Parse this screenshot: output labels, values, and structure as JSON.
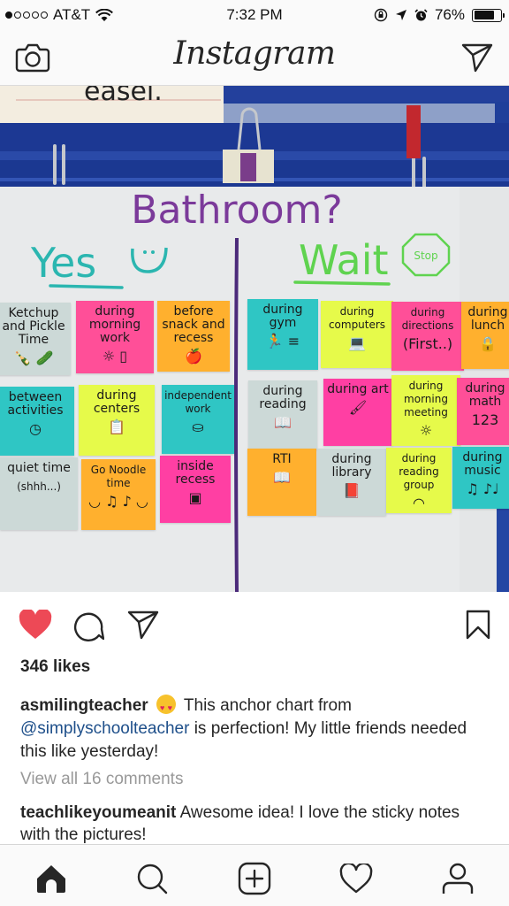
{
  "status_bar": {
    "signal_bars_filled": 1,
    "signal_bars_total": 5,
    "carrier": "AT&T",
    "time": "7:32 PM",
    "battery_percent_label": "76%",
    "battery_level": 0.76
  },
  "header": {
    "logo": "Instagram",
    "icons": [
      "camera-icon",
      "direct-message-icon"
    ]
  },
  "photo": {
    "easel_label": "easel.",
    "chart_title": "Bathroom?",
    "yes_heading": "Yes",
    "wait_heading": "Wait",
    "stop_sign": "stop",
    "yes_notes": [
      {
        "text": "Ketchup and Pickle Time",
        "icon": "🍾 🥒"
      },
      {
        "text": "during morning work",
        "icon": "☼ ▯"
      },
      {
        "text": "before snack and recess",
        "icon": "🍎"
      },
      {
        "text": "between activities",
        "icon": "◷"
      },
      {
        "text": "during centers",
        "icon": "📋"
      },
      {
        "text": "independent work",
        "icon": "⛀"
      },
      {
        "text": "quiet time",
        "icon": "(shhh...)"
      },
      {
        "text": "Go Noodle time",
        "icon": "◡ ♫ ♪ ◡"
      },
      {
        "text": "inside recess",
        "icon": "▣"
      }
    ],
    "wait_notes": [
      {
        "text": "during gym",
        "icon": "🏃 ≡"
      },
      {
        "text": "during computers",
        "icon": "💻"
      },
      {
        "text": "during directions",
        "icon": "(First..)"
      },
      {
        "text": "during lunch",
        "icon": "🔒"
      },
      {
        "text": "during reading",
        "icon": "📖"
      },
      {
        "text": "during art",
        "icon": "🖌"
      },
      {
        "text": "during morning meeting",
        "icon": "☼"
      },
      {
        "text": "during math",
        "icon": "123"
      },
      {
        "text": "RTI",
        "icon": "📖"
      },
      {
        "text": "during library",
        "icon": "📕"
      },
      {
        "text": "during reading group",
        "icon": "◠"
      },
      {
        "text": "during music",
        "icon": "♫ ♪♩"
      }
    ]
  },
  "actions": {
    "liked": true,
    "like_color": "#ed4956",
    "icons": [
      "heart-icon",
      "comment-icon",
      "share-icon",
      "bookmark-icon"
    ]
  },
  "likes_label": "346 likes",
  "caption": {
    "username": "asmilingteacher",
    "emoji": "heart-eyes",
    "text_before_mention": "This anchor chart from",
    "mention": "@simplyschoolteacher",
    "text_after_mention": " is perfection! My little friends needed this like yesterday!"
  },
  "view_comments_label": "View all 16 comments",
  "comment": {
    "username": "teachlikeyoumeanit",
    "text": " Awesome idea! I love the sticky notes with the pictures!"
  },
  "tabbar": {
    "tabs": [
      "home",
      "search",
      "new-post",
      "activity",
      "profile"
    ],
    "active": "home"
  }
}
